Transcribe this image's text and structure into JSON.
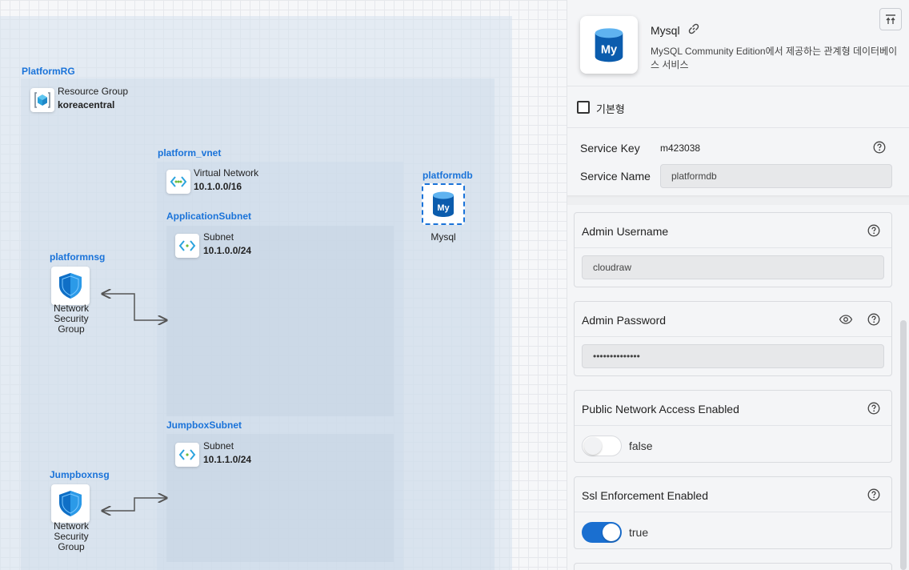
{
  "canvas": {
    "groups": {
      "resource_group_name": "PlatformRG",
      "vnet_name": "platform_vnet",
      "app_subnet_name": "ApplicationSubnet",
      "jump_subnet_name": "JumpboxSubnet",
      "nsg1_name": "platformnsg",
      "nsg2_name": "Jumpboxnsg",
      "db_name": "platformdb"
    },
    "nodes": {
      "resource_group": {
        "type": "Resource Group",
        "value": "koreacentral"
      },
      "vnet": {
        "type": "Virtual Network",
        "value": "10.1.0.0/16"
      },
      "app_subnet": {
        "type": "Subnet",
        "value": "10.1.0.0/24"
      },
      "jump_subnet": {
        "type": "Subnet",
        "value": "10.1.1.0/24"
      },
      "nsg1": {
        "line1": "Network",
        "line2": "Security",
        "line3": "Group"
      },
      "nsg2": {
        "line1": "Network",
        "line2": "Security",
        "line3": "Group"
      },
      "mysql": {
        "label": "Mysql"
      }
    },
    "colors": {
      "accent": "#1a73d9",
      "azure_blue": "#0078d4"
    }
  },
  "panel": {
    "title": "Mysql",
    "description": "MySQL Community Edition에서 제공하는 관계형 데이터베이스 서비스",
    "basic_label": "기본형",
    "basic_checked": false,
    "service_key_label": "Service Key",
    "service_key_value": "m423038",
    "service_name_label": "Service Name",
    "service_name_value": "platformdb",
    "admin_username": {
      "label": "Admin Username",
      "value": "cloudraw"
    },
    "admin_password": {
      "label": "Admin Password",
      "value": "••••••••••••••"
    },
    "public_network": {
      "label": "Public Network Access Enabled",
      "enabled": false,
      "state_label": "false"
    },
    "ssl": {
      "label": "Ssl Enforcement Enabled",
      "enabled": true,
      "state_label": "true"
    },
    "icons": [
      "database-icon",
      "link-icon",
      "collapse-icon",
      "help-icon",
      "eye-icon"
    ]
  }
}
